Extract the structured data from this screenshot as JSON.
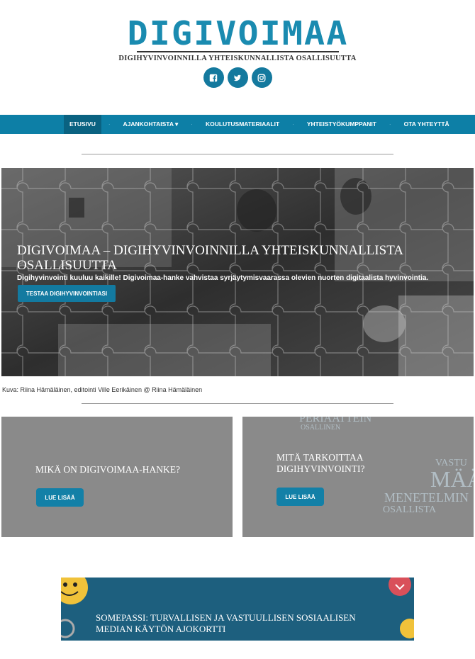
{
  "header": {
    "logo_title": "DIGIVOIMAA",
    "logo_subtitle": "DIGIHYVINVOINNILLA YHTEISKUNNALLISTA OSALLISUUTTA",
    "brand_color": "#1a8bb0",
    "social": [
      {
        "icon": "facebook-icon"
      },
      {
        "icon": "twitter-icon"
      },
      {
        "icon": "instagram-icon"
      }
    ]
  },
  "nav": {
    "items": [
      {
        "label": "ETUSIVU",
        "active": true
      },
      {
        "label": "AJANKOHTAISTA ▾",
        "active": false
      },
      {
        "label": "KOULUTUSMATERIAALIT",
        "active": false
      },
      {
        "label": "YHTEISTYÖKUMPPANIT",
        "active": false
      },
      {
        "label": "OTA YHTEYTTÄ",
        "active": false
      }
    ],
    "background": "#0d7fa6"
  },
  "hero": {
    "title": "DIGIVOIMAA – DIGIHYVINVOINNILLA YHTEISKUNNALLISTA OSALLISUUTTA",
    "lead": "Digihyvinvointi kuuluu kaikille! Digivoimaa-hanke vahvistaa syrjäytymisvaarassa olevien nuorten digitaalista hyvinvointia.",
    "button_label": "TESTAA DIGIHYVINVOINTIASI",
    "caption": "Kuva: Riina Hämäläinen, editointi Ville Eerikäinen @ Riina Hämäläinen"
  },
  "cards": [
    {
      "title": "MIKÄ ON DIGIVOIMAA-HANKE?",
      "button_label": "LUE LISÄÄ"
    },
    {
      "title": "MITÄ TARKOITTAA DIGIHYVINVOINTI?",
      "button_label": "LUE LISÄÄ",
      "background_words": [
        "PERIAATTEIN",
        "OSALLINEN",
        "VASTU",
        "MÄÄ",
        "MENETELMIN",
        "OSALLISTA"
      ]
    }
  ],
  "somepassi": {
    "title": "SOMEPASSI: TURVALLISEN JA VASTUULLISEN SOSIAALISEN MEDIAN KÄYTÖN AJOKORTTI"
  }
}
